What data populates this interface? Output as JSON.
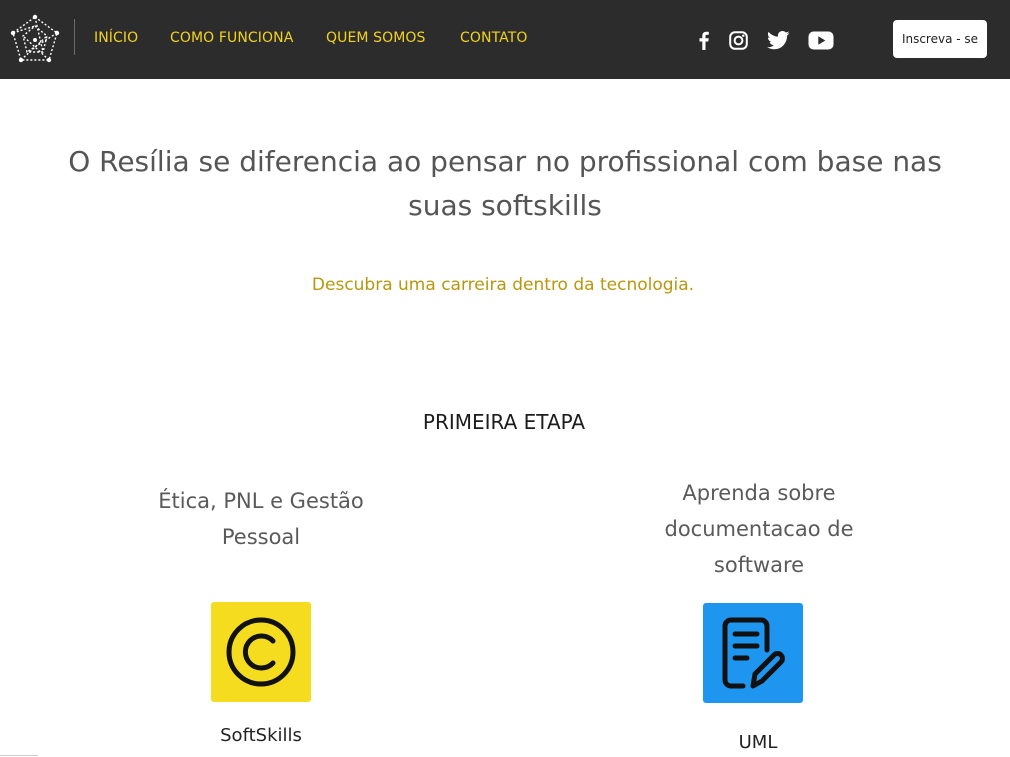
{
  "header": {
    "logo_icon": "network-pentagon-logo-icon",
    "nav": [
      {
        "label": "INÍCIO"
      },
      {
        "label": "COMO FUNCIONA"
      },
      {
        "label": "QUEM SOMOS"
      },
      {
        "label": "CONTATO"
      }
    ],
    "social_icons": [
      "facebook-icon",
      "instagram-icon",
      "twitter-icon",
      "youtube-icon"
    ],
    "subscribe_label": "Inscreva - se",
    "nav_color": "#f2d21e",
    "background": "#2c2c2c"
  },
  "hero": {
    "title": "O Resília se diferencia ao pensar no profissional com base nas suas softskills",
    "subtitle": "Descubra uma carreira dentro da tecnologia.",
    "subtitle_color": "#b8970e"
  },
  "step": {
    "title": "PRIMEIRA ETAPA",
    "cards": [
      {
        "title": "Ética, PNL e Gestão Pessoal",
        "icon": "copyright-icon",
        "icon_bg": "#f5dc1f",
        "label": "SoftSkills"
      },
      {
        "title": "Aprenda sobre documentacao de software",
        "icon": "document-edit-icon",
        "icon_bg": "#1e96f0",
        "label": "UML"
      }
    ]
  }
}
